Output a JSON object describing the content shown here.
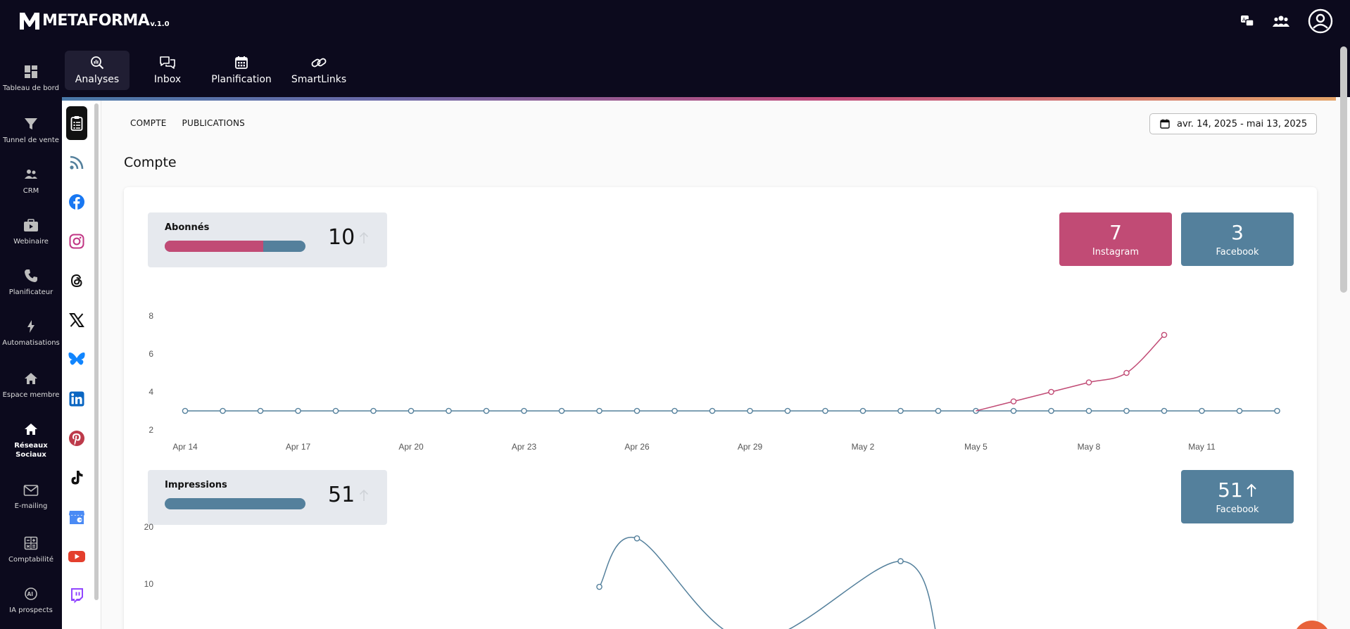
{
  "app": {
    "name": "METAFORMA",
    "version": "v.1.0"
  },
  "top_nav": [
    {
      "label": "Analyses",
      "icon": "analytics-search-icon",
      "active": true
    },
    {
      "label": "Inbox",
      "icon": "chat-bubbles-icon",
      "active": false
    },
    {
      "label": "Planification",
      "icon": "calendar-icon",
      "active": false
    },
    {
      "label": "SmartLinks",
      "icon": "link-icon",
      "active": false
    }
  ],
  "top_right_icons": [
    "translate-chat-icon",
    "users-group-icon",
    "account-circle-icon"
  ],
  "left_nav": [
    {
      "label": "Tableau de bord",
      "icon": "dashboard-icon"
    },
    {
      "label": "Tunnel de vente",
      "icon": "funnel-icon"
    },
    {
      "label": "CRM",
      "icon": "contacts-icon"
    },
    {
      "label": "Webinaire",
      "icon": "video-case-icon"
    },
    {
      "label": "Planificateur",
      "icon": "phone-icon"
    },
    {
      "label": "Automatisations",
      "icon": "bolt-icon"
    },
    {
      "label": "Espace membre",
      "icon": "home-icon"
    },
    {
      "label": "Réseaux Sociaux",
      "icon": "home-icon",
      "active": true
    },
    {
      "label": "E-mailing",
      "icon": "mail-icon"
    },
    {
      "label": "Comptabilité",
      "icon": "calculator-icon"
    },
    {
      "label": "IA prospects",
      "icon": "ai-chip-icon"
    }
  ],
  "social_nav": [
    {
      "name": "overview",
      "icon": "clipboard-icon",
      "active": true
    },
    {
      "name": "rss",
      "icon": "rss-icon"
    },
    {
      "name": "facebook",
      "icon": "facebook-icon"
    },
    {
      "name": "instagram",
      "icon": "instagram-icon"
    },
    {
      "name": "threads",
      "icon": "threads-icon"
    },
    {
      "name": "x",
      "icon": "x-icon"
    },
    {
      "name": "bluesky",
      "icon": "bluesky-icon"
    },
    {
      "name": "linkedin",
      "icon": "linkedin-icon"
    },
    {
      "name": "pinterest",
      "icon": "pinterest-icon"
    },
    {
      "name": "tiktok",
      "icon": "tiktok-icon"
    },
    {
      "name": "google-business",
      "icon": "google-business-icon"
    },
    {
      "name": "youtube",
      "icon": "youtube-icon"
    },
    {
      "name": "twitch",
      "icon": "twitch-icon"
    }
  ],
  "sub_tabs": [
    "COMPTE",
    "PUBLICATIONS"
  ],
  "date_range": "avr. 14, 2025 - mai 13, 2025",
  "section_title": "Compte",
  "colors": {
    "instagram": "#c14b75",
    "facebook": "#54809c",
    "nav_bg": "#0c0a1d"
  },
  "abonnes": {
    "label": "Abonnés",
    "total": "10",
    "bar_fraction_instagram": 0.7,
    "platforms": [
      {
        "value": "7",
        "name": "Instagram",
        "color": "#c14b75"
      },
      {
        "value": "3",
        "name": "Facebook",
        "color": "#54809c"
      }
    ]
  },
  "impressions": {
    "label": "Impressions",
    "total": "51",
    "bar_fraction_facebook": 1.0,
    "platforms": [
      {
        "value": "51",
        "name": "Facebook",
        "color": "#54809c"
      }
    ]
  },
  "chart_data": [
    {
      "type": "line",
      "x": [
        "Apr 14",
        "Apr 15",
        "Apr 16",
        "Apr 17",
        "Apr 18",
        "Apr 19",
        "Apr 20",
        "Apr 21",
        "Apr 22",
        "Apr 23",
        "Apr 24",
        "Apr 25",
        "Apr 26",
        "Apr 27",
        "Apr 28",
        "Apr 29",
        "Apr 30",
        "May 1",
        "May 2",
        "May 3",
        "May 4",
        "May 5",
        "May 6",
        "May 7",
        "May 8",
        "May 9",
        "May 10",
        "May 11",
        "May 12",
        "May 13"
      ],
      "x_tick_labels": [
        "Apr 14",
        "Apr 17",
        "Apr 20",
        "Apr 23",
        "Apr 26",
        "Apr 29",
        "May 2",
        "May 5",
        "May 8",
        "May 11"
      ],
      "y_ticks": [
        "2",
        "4",
        "6",
        "8"
      ],
      "ylim": [
        2,
        8
      ],
      "series": [
        {
          "color": "#54809c",
          "values": [
            3,
            3,
            3,
            3,
            3,
            3,
            3,
            3,
            3,
            3,
            3,
            3,
            3,
            3,
            3,
            3,
            3,
            3,
            3,
            3,
            3,
            3,
            3,
            3,
            3,
            3,
            3,
            3,
            3,
            3
          ]
        },
        {
          "color": "#c14b75",
          "start_index": 21,
          "values": [
            3,
            3.5,
            4,
            4.5,
            5,
            7
          ]
        }
      ]
    },
    {
      "type": "line",
      "y_ticks": [
        "10",
        "20"
      ],
      "ylim": [
        0,
        20
      ],
      "series": [
        {
          "color": "#54809c",
          "points": [
            [
              11,
              9.5
            ],
            [
              12,
              18
            ],
            [
              15,
              0
            ],
            [
              19,
              14
            ],
            [
              20,
              0
            ]
          ]
        }
      ]
    }
  ]
}
